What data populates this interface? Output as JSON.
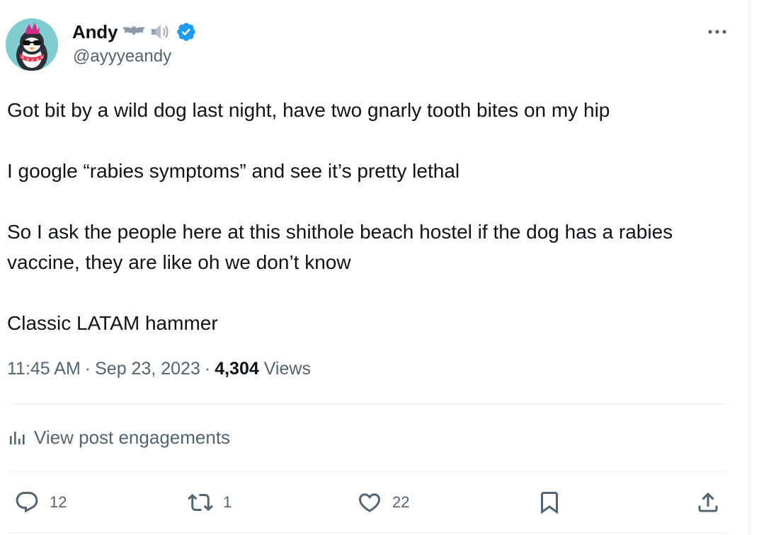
{
  "author": {
    "display_name": "Andy",
    "name_emojis": [
      "bat-emoji",
      "speaker-emoji"
    ],
    "verified": true,
    "handle": "@ayyyeandy",
    "avatar_desc": "penguin-avatar"
  },
  "tweet": {
    "paragraphs": [
      "Got bit by a wild dog last night, have two gnarly tooth bites on my hip",
      "I google “rabies symptoms” and see it’s pretty lethal",
      "So I ask the people here at this shithole beach hostel if the dog has a rabies vaccine, they are like oh we don’t know",
      "Classic LATAM hammer"
    ],
    "time": "11:45 AM",
    "date": "Sep 23, 2023",
    "separator": "·",
    "views_count": "4,304",
    "views_label": "Views"
  },
  "engagements_label": "View post engagements",
  "actions": {
    "replies": "12",
    "reposts": "1",
    "likes": "22"
  },
  "colors": {
    "text": "#0f1419",
    "secondary": "#536471",
    "verified": "#1d9bf0",
    "divider": "#eff3f4"
  }
}
